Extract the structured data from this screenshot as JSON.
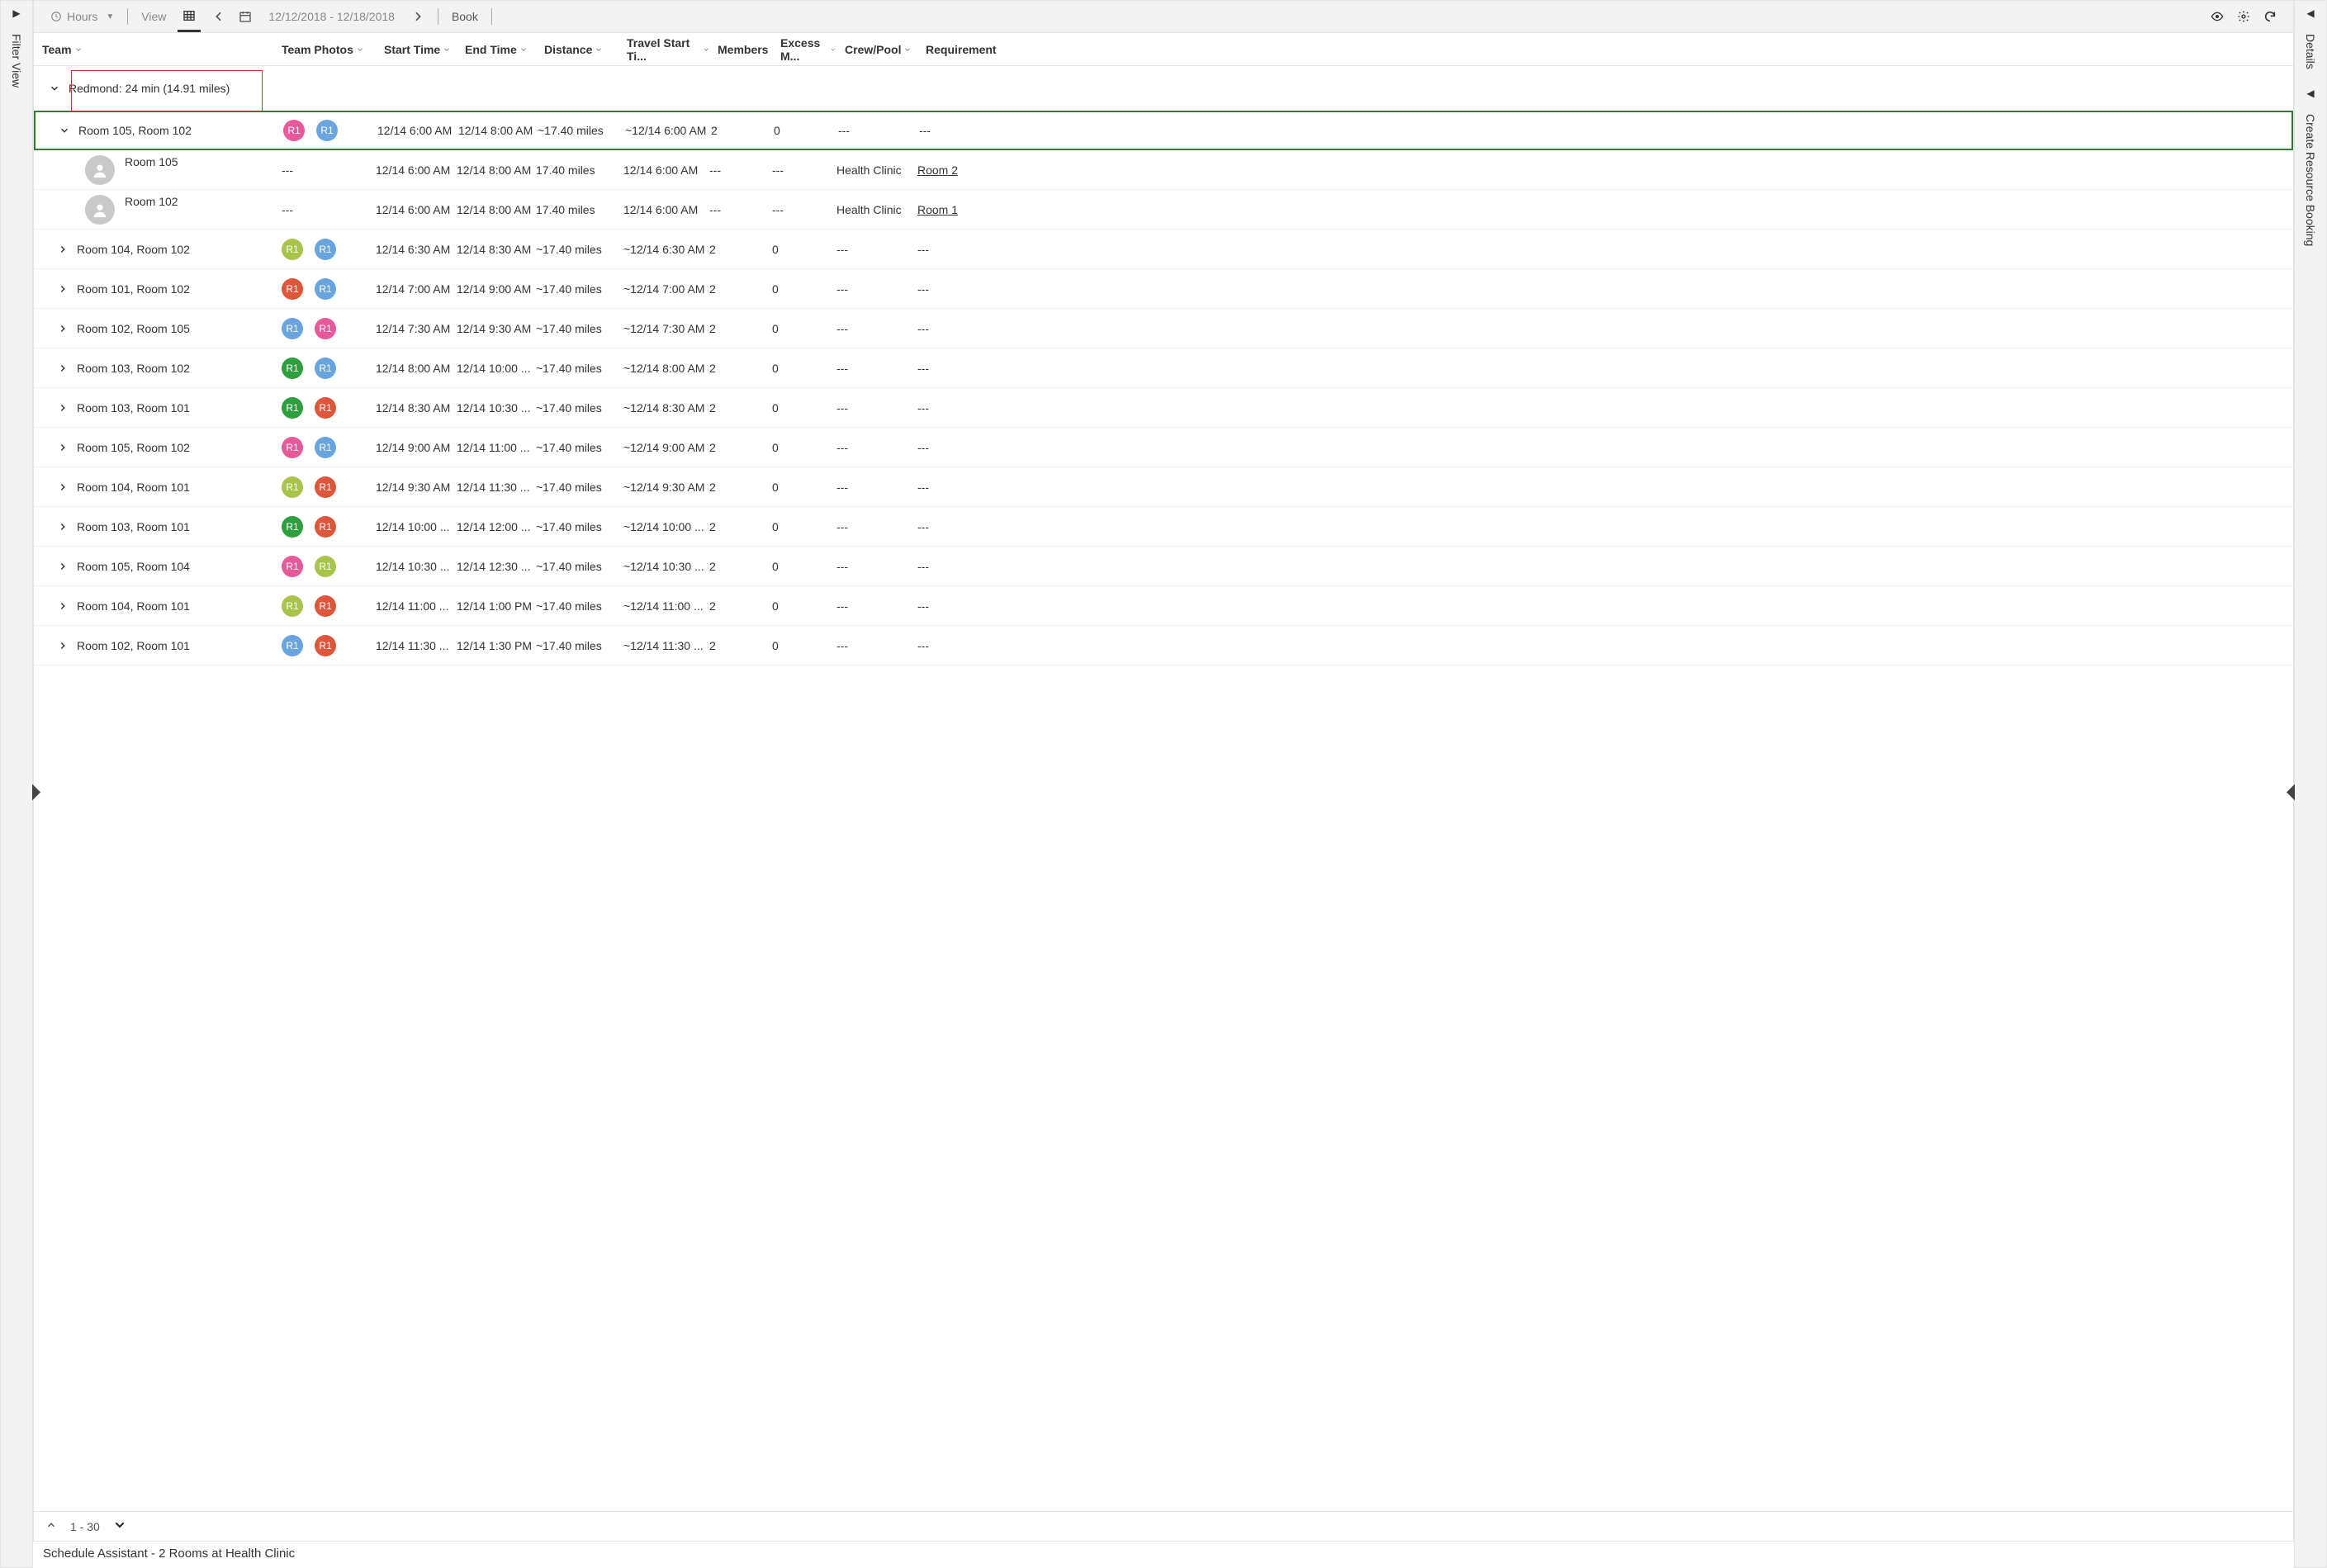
{
  "rails": {
    "left_label": "Filter View",
    "right_label_1": "Details",
    "right_label_2": "Create Resource Booking"
  },
  "toolbar": {
    "hours_label": "Hours",
    "view_label": "View",
    "date_range": "12/12/2018 - 12/18/2018",
    "book_label": "Book"
  },
  "columns": {
    "team": "Team",
    "photos": "Team Photos",
    "start": "Start Time",
    "end": "End Time",
    "dist": "Distance",
    "travel": "Travel Start Ti...",
    "members": "Members",
    "excess": "Excess M...",
    "crew": "Crew/Pool",
    "req": "Requirement"
  },
  "group_row": "Redmond: 24 min (14.91 miles)",
  "child_rows": [
    {
      "name": "Room 105",
      "photos": "---",
      "start": "12/14 6:00 AM",
      "end": "12/14 8:00 AM",
      "dist": "17.40 miles",
      "travel": "12/14 6:00 AM",
      "members": "---",
      "excess": "---",
      "crew": "Health Clinic",
      "req": "Room 2"
    },
    {
      "name": "Room 102",
      "photos": "---",
      "start": "12/14 6:00 AM",
      "end": "12/14 8:00 AM",
      "dist": "17.40 miles",
      "travel": "12/14 6:00 AM",
      "members": "---",
      "excess": "---",
      "crew": "Health Clinic",
      "req": "Room 1"
    }
  ],
  "avatar_colors": {
    "pink": "#e8599c",
    "blue": "#6aa5e0",
    "olive": "#a8c44b",
    "red": "#e0563b",
    "green": "#2e9e3f"
  },
  "rows": [
    {
      "team": "Room 105, Room 102",
      "av": [
        "pink",
        "blue"
      ],
      "start": "12/14 6:00 AM",
      "end": "12/14 8:00 AM",
      "dist": "~17.40 miles",
      "travel": "~12/14 6:00 AM",
      "members": "2",
      "excess": "0",
      "crew": "---",
      "req": "---",
      "expanded": true
    },
    {
      "team": "Room 104, Room 102",
      "av": [
        "olive",
        "blue"
      ],
      "start": "12/14 6:30 AM",
      "end": "12/14 8:30 AM",
      "dist": "~17.40 miles",
      "travel": "~12/14 6:30 AM",
      "members": "2",
      "excess": "0",
      "crew": "---",
      "req": "---"
    },
    {
      "team": "Room 101, Room 102",
      "av": [
        "red",
        "blue"
      ],
      "start": "12/14 7:00 AM",
      "end": "12/14 9:00 AM",
      "dist": "~17.40 miles",
      "travel": "~12/14 7:00 AM",
      "members": "2",
      "excess": "0",
      "crew": "---",
      "req": "---"
    },
    {
      "team": "Room 102, Room 105",
      "av": [
        "blue",
        "pink"
      ],
      "start": "12/14 7:30 AM",
      "end": "12/14 9:30 AM",
      "dist": "~17.40 miles",
      "travel": "~12/14 7:30 AM",
      "members": "2",
      "excess": "0",
      "crew": "---",
      "req": "---"
    },
    {
      "team": "Room 103, Room 102",
      "av": [
        "green",
        "blue"
      ],
      "start": "12/14 8:00 AM",
      "end": "12/14 10:00 ...",
      "dist": "~17.40 miles",
      "travel": "~12/14 8:00 AM",
      "members": "2",
      "excess": "0",
      "crew": "---",
      "req": "---"
    },
    {
      "team": "Room 103, Room 101",
      "av": [
        "green",
        "red"
      ],
      "start": "12/14 8:30 AM",
      "end": "12/14 10:30 ...",
      "dist": "~17.40 miles",
      "travel": "~12/14 8:30 AM",
      "members": "2",
      "excess": "0",
      "crew": "---",
      "req": "---"
    },
    {
      "team": "Room 105, Room 102",
      "av": [
        "pink",
        "blue"
      ],
      "start": "12/14 9:00 AM",
      "end": "12/14 11:00 ...",
      "dist": "~17.40 miles",
      "travel": "~12/14 9:00 AM",
      "members": "2",
      "excess": "0",
      "crew": "---",
      "req": "---"
    },
    {
      "team": "Room 104, Room 101",
      "av": [
        "olive",
        "red"
      ],
      "start": "12/14 9:30 AM",
      "end": "12/14 11:30 ...",
      "dist": "~17.40 miles",
      "travel": "~12/14 9:30 AM",
      "members": "2",
      "excess": "0",
      "crew": "---",
      "req": "---"
    },
    {
      "team": "Room 103, Room 101",
      "av": [
        "green",
        "red"
      ],
      "start": "12/14 10:00 ...",
      "end": "12/14 12:00 ...",
      "dist": "~17.40 miles",
      "travel": "~12/14 10:00 ...",
      "members": "2",
      "excess": "0",
      "crew": "---",
      "req": "---"
    },
    {
      "team": "Room 105, Room 104",
      "av": [
        "pink",
        "olive"
      ],
      "start": "12/14 10:30 ...",
      "end": "12/14 12:30 ...",
      "dist": "~17.40 miles",
      "travel": "~12/14 10:30 ...",
      "members": "2",
      "excess": "0",
      "crew": "---",
      "req": "---"
    },
    {
      "team": "Room 104, Room 101",
      "av": [
        "olive",
        "red"
      ],
      "start": "12/14 11:00 ...",
      "end": "12/14 1:00 PM",
      "dist": "~17.40 miles",
      "travel": "~12/14 11:00 ...",
      "members": "2",
      "excess": "0",
      "crew": "---",
      "req": "---"
    },
    {
      "team": "Room 102, Room 101",
      "av": [
        "blue",
        "red"
      ],
      "start": "12/14 11:30 ...",
      "end": "12/14 1:30 PM",
      "dist": "~17.40 miles",
      "travel": "~12/14 11:30 ...",
      "members": "2",
      "excess": "0",
      "crew": "---",
      "req": "---"
    }
  ],
  "paging": {
    "range": "1 - 30"
  },
  "status": "Schedule Assistant - 2 Rooms at Health Clinic",
  "avatar_text": "R1"
}
